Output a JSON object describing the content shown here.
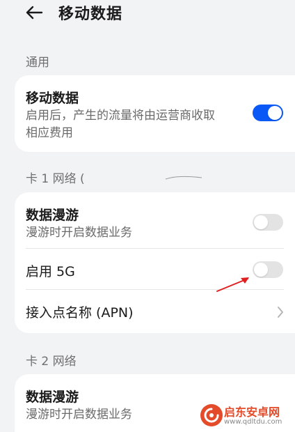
{
  "header": {
    "title": "移动数据",
    "back_icon": "arrow-left-icon"
  },
  "sections": {
    "general": {
      "title": "通用"
    },
    "card1": {
      "title": "卡 1 网络 ("
    },
    "card2": {
      "title": "卡 2 网络"
    }
  },
  "general_card": {
    "mobile_data": {
      "title": "移动数据",
      "subtitle_line1": "启用后，产生的流量将由运营商收取",
      "subtitle_line2": "相应费用",
      "toggle_on": true
    }
  },
  "card1": {
    "roaming": {
      "title": "数据漫游",
      "subtitle": "漫游时开启数据业务",
      "toggle_on": false
    },
    "enable_5g": {
      "title": "启用 5G",
      "toggle_on": false
    },
    "apn": {
      "title": "接入点名称 (APN)"
    }
  },
  "card2": {
    "roaming": {
      "title": "数据漫游",
      "subtitle": "漫游时开启数据业务"
    }
  },
  "watermark": {
    "name": "启东安卓网",
    "url": "www.qdltdu.com"
  },
  "colors": {
    "accent": "#0a59f7",
    "annotation_arrow": "#e02020",
    "background": "#f1f3f5"
  }
}
